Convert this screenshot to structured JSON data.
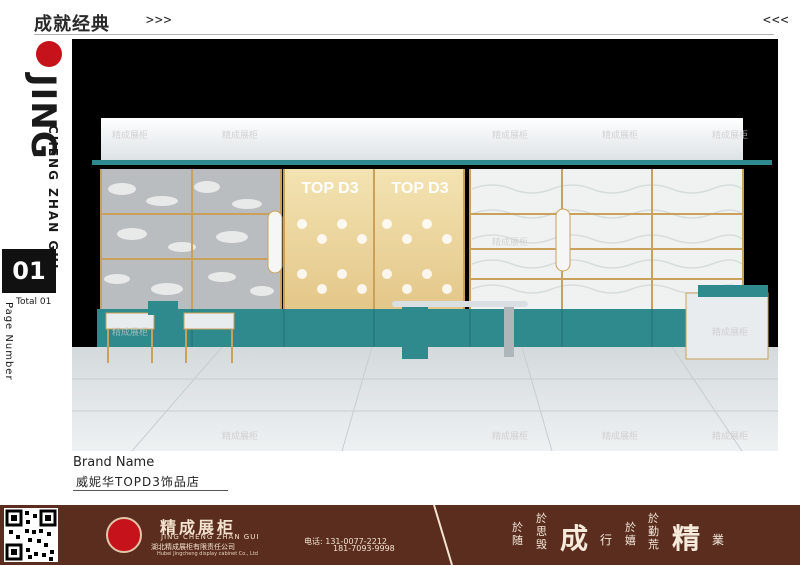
{
  "header": {
    "title": "成就经典",
    "chevron_right": ">>>",
    "chevron_left": "<<<"
  },
  "brand": {
    "main": "JING",
    "sub": "CHENG ZHAN GUI"
  },
  "page": {
    "number": "01",
    "total": "Total 01",
    "label": "Page Number"
  },
  "render": {
    "signs": [
      "TOP D3",
      "TOP D3"
    ],
    "watermark": "精成展柜"
  },
  "caption": {
    "brand_label": "Brand Name",
    "store_name": "威妮华TOPD3饰品店"
  },
  "footer": {
    "company": "精成展柜",
    "pinyin": "JING CHENG ZHAN GUI",
    "company_cn": "湖北精成展柜有限责任公司",
    "company_en": "Hubei Jingcheng display cabinet Co., Ltd",
    "phone_label": "电话:",
    "phone1": "131-0077-2212",
    "phone2": "181-7093-9998",
    "slogan": {
      "s1": "於随",
      "s2": "於思毁",
      "big1": "成",
      "s3": "行",
      "s4": "於嬉",
      "s5": "於勤荒",
      "big2": "精",
      "s6": "業"
    }
  },
  "colors": {
    "footer_bg": "#5a2d1f",
    "teal": "#2f8a8d",
    "brand_red": "#c5121b",
    "gold": "#c9a15a"
  }
}
